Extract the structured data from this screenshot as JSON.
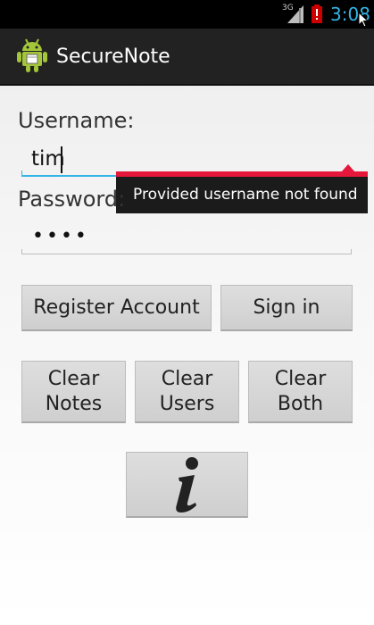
{
  "status_bar": {
    "network": "3G",
    "time": "3:08",
    "colors": {
      "time": "#33b5e5",
      "battery": "#cc0000"
    }
  },
  "action_bar": {
    "title": "SecureNote",
    "icon": "android-robot-icon"
  },
  "form": {
    "username_label": "Username:",
    "username_value": "tim",
    "password_label": "Password:",
    "password_value": "••••",
    "error_message": "Provided username not found",
    "colors": {
      "error_accent": "#e5173b",
      "focus_underline": "#33b5e5"
    }
  },
  "buttons": {
    "register": "Register Account",
    "sign_in": "Sign in",
    "clear_notes": [
      "Clear",
      "Notes"
    ],
    "clear_users": [
      "Clear",
      "Users"
    ],
    "clear_both": [
      "Clear",
      "Both"
    ],
    "info_icon": "info-icon"
  }
}
